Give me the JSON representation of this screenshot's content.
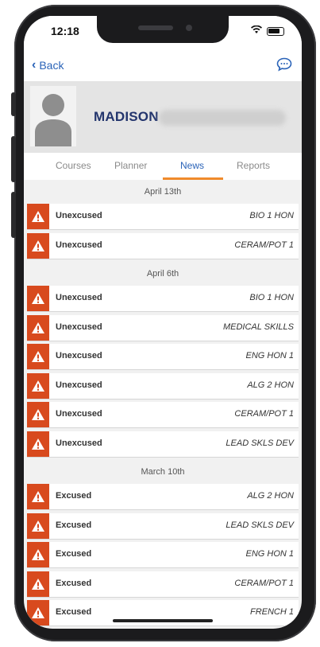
{
  "status_bar": {
    "time": "12:18",
    "wifi_icon": "wifi-icon",
    "battery_icon": "battery-icon"
  },
  "nav": {
    "back_label": "Back",
    "message_icon": "chat-bubble-icon"
  },
  "profile": {
    "name": "MADISON"
  },
  "tabs": [
    {
      "label": "Courses",
      "active": false
    },
    {
      "label": "Planner",
      "active": false
    },
    {
      "label": "News",
      "active": true
    },
    {
      "label": "Reports",
      "active": false
    }
  ],
  "colors": {
    "accent": "#2a63b8",
    "tab_underline": "#f08a2b",
    "warning": "#d84a1e",
    "name": "#23356d"
  },
  "sections": [
    {
      "date": "April 13th",
      "items": [
        {
          "status": "Unexcused",
          "course": "BIO 1 HON"
        },
        {
          "status": "Unexcused",
          "course": "CERAM/POT 1"
        }
      ]
    },
    {
      "date": "April 6th",
      "items": [
        {
          "status": "Unexcused",
          "course": "BIO 1 HON"
        },
        {
          "status": "Unexcused",
          "course": "MEDICAL SKILLS"
        },
        {
          "status": "Unexcused",
          "course": "ENG HON 1"
        },
        {
          "status": "Unexcused",
          "course": "ALG 2 HON"
        },
        {
          "status": "Unexcused",
          "course": "CERAM/POT 1"
        },
        {
          "status": "Unexcused",
          "course": "LEAD SKLS DEV"
        }
      ]
    },
    {
      "date": "March 10th",
      "items": [
        {
          "status": "Excused",
          "course": "ALG 2 HON"
        },
        {
          "status": "Excused",
          "course": "LEAD SKLS DEV"
        },
        {
          "status": "Excused",
          "course": "ENG HON 1"
        },
        {
          "status": "Excused",
          "course": "CERAM/POT 1"
        },
        {
          "status": "Excused",
          "course": "FRENCH 1"
        }
      ]
    }
  ]
}
